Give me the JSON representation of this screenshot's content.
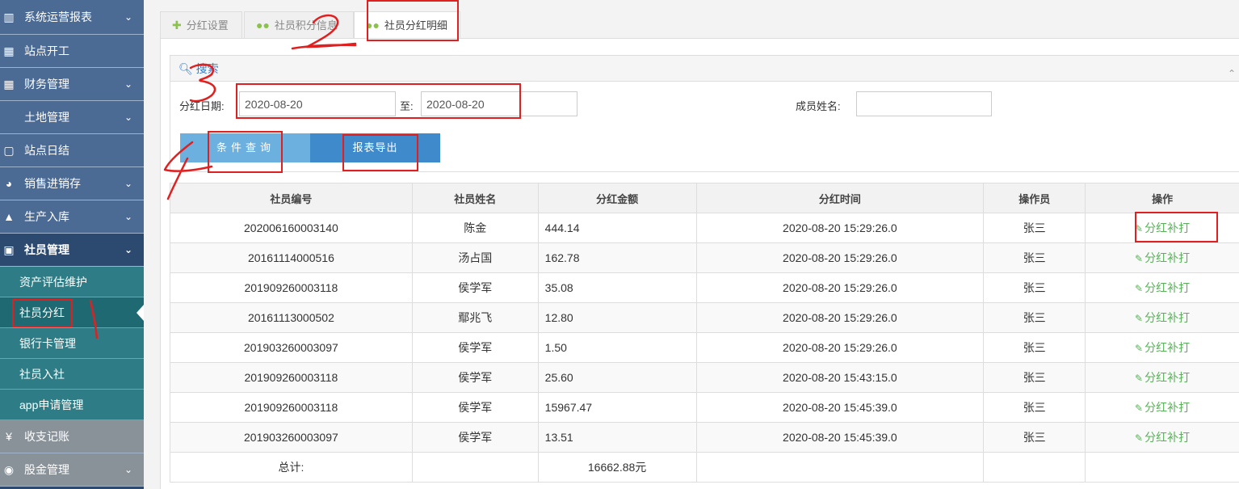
{
  "sidebar": {
    "items": [
      {
        "icon": "bar-chart-icon",
        "glyph": "▥",
        "label": "系统运营报表",
        "chevron": true
      },
      {
        "icon": "calendar-icon",
        "glyph": "▦",
        "label": "站点开工",
        "chevron": false
      },
      {
        "icon": "table-icon",
        "glyph": "▦",
        "label": "财务管理",
        "chevron": true
      },
      {
        "icon": "",
        "glyph": "",
        "label": "土地管理",
        "chevron": true
      },
      {
        "icon": "calendar-icon",
        "glyph": "▢",
        "label": "站点日结",
        "chevron": false
      },
      {
        "icon": "pie-chart-icon",
        "glyph": "◕",
        "label": "销售进销存",
        "chevron": true
      },
      {
        "icon": "bank-icon",
        "glyph": "▲",
        "label": "生产入库",
        "chevron": true
      },
      {
        "icon": "image-icon",
        "glyph": "▣",
        "label": "社员管理",
        "chevron": true
      }
    ],
    "sub_items": [
      "资产评估维护",
      "社员分红",
      "银行卡管理",
      "社员入社",
      "app申请管理"
    ],
    "bottom_items": [
      {
        "icon": "yen-icon",
        "glyph": "¥",
        "label": "收支记账",
        "chevron": false
      },
      {
        "icon": "database-icon",
        "glyph": "◉",
        "label": "股金管理",
        "chevron": true
      }
    ]
  },
  "tabs": [
    {
      "icon": "plus-icon",
      "glyph": "✚",
      "label": "分红设置"
    },
    {
      "icon": "users-icon",
      "glyph": "👥",
      "label": "社员积分信息"
    },
    {
      "icon": "users-icon",
      "glyph": "👥",
      "label": "社员分红明细"
    }
  ],
  "search": {
    "title": "搜索",
    "date_label": "分红日期:",
    "date_from": "2020-08-20",
    "to_label": "至:",
    "date_to": "2020-08-20",
    "name_label": "成员姓名:",
    "name_value": "",
    "query_button": "条件查询",
    "export_button": "报表导出"
  },
  "table": {
    "columns": [
      "社员编号",
      "社员姓名",
      "分红金额",
      "分红时间",
      "操作员",
      "操作"
    ],
    "rows": [
      {
        "id": "202006160003140",
        "name": "陈金",
        "amount": "444.14",
        "time": "2020-08-20 15:29:26.0",
        "operator": "张三",
        "action": "分红补打"
      },
      {
        "id": "20161114000516",
        "name": "汤占国",
        "amount": "162.78",
        "time": "2020-08-20 15:29:26.0",
        "operator": "张三",
        "action": "分红补打"
      },
      {
        "id": "201909260003118",
        "name": "侯学军",
        "amount": "35.08",
        "time": "2020-08-20 15:29:26.0",
        "operator": "张三",
        "action": "分红补打"
      },
      {
        "id": "20161113000502",
        "name": "鄢兆飞",
        "amount": "12.80",
        "time": "2020-08-20 15:29:26.0",
        "operator": "张三",
        "action": "分红补打"
      },
      {
        "id": "201903260003097",
        "name": "侯学军",
        "amount": "1.50",
        "time": "2020-08-20 15:29:26.0",
        "operator": "张三",
        "action": "分红补打"
      },
      {
        "id": "201909260003118",
        "name": "侯学军",
        "amount": "25.60",
        "time": "2020-08-20 15:43:15.0",
        "operator": "张三",
        "action": "分红补打"
      },
      {
        "id": "201909260003118",
        "name": "侯学军",
        "amount": "15967.47",
        "time": "2020-08-20 15:45:39.0",
        "operator": "张三",
        "action": "分红补打"
      },
      {
        "id": "201903260003097",
        "name": "侯学军",
        "amount": "13.51",
        "time": "2020-08-20 15:45:39.0",
        "operator": "张三",
        "action": "分红补打"
      }
    ],
    "total_label": "总计:",
    "total_value": "16662.88元"
  },
  "colors": {
    "sidebar_bg": "#4b6a94",
    "submenu_bg": "#2e7d86",
    "accent_blue": "#3f8acb",
    "action_green": "#58b158",
    "annotation_red": "#e02020"
  }
}
